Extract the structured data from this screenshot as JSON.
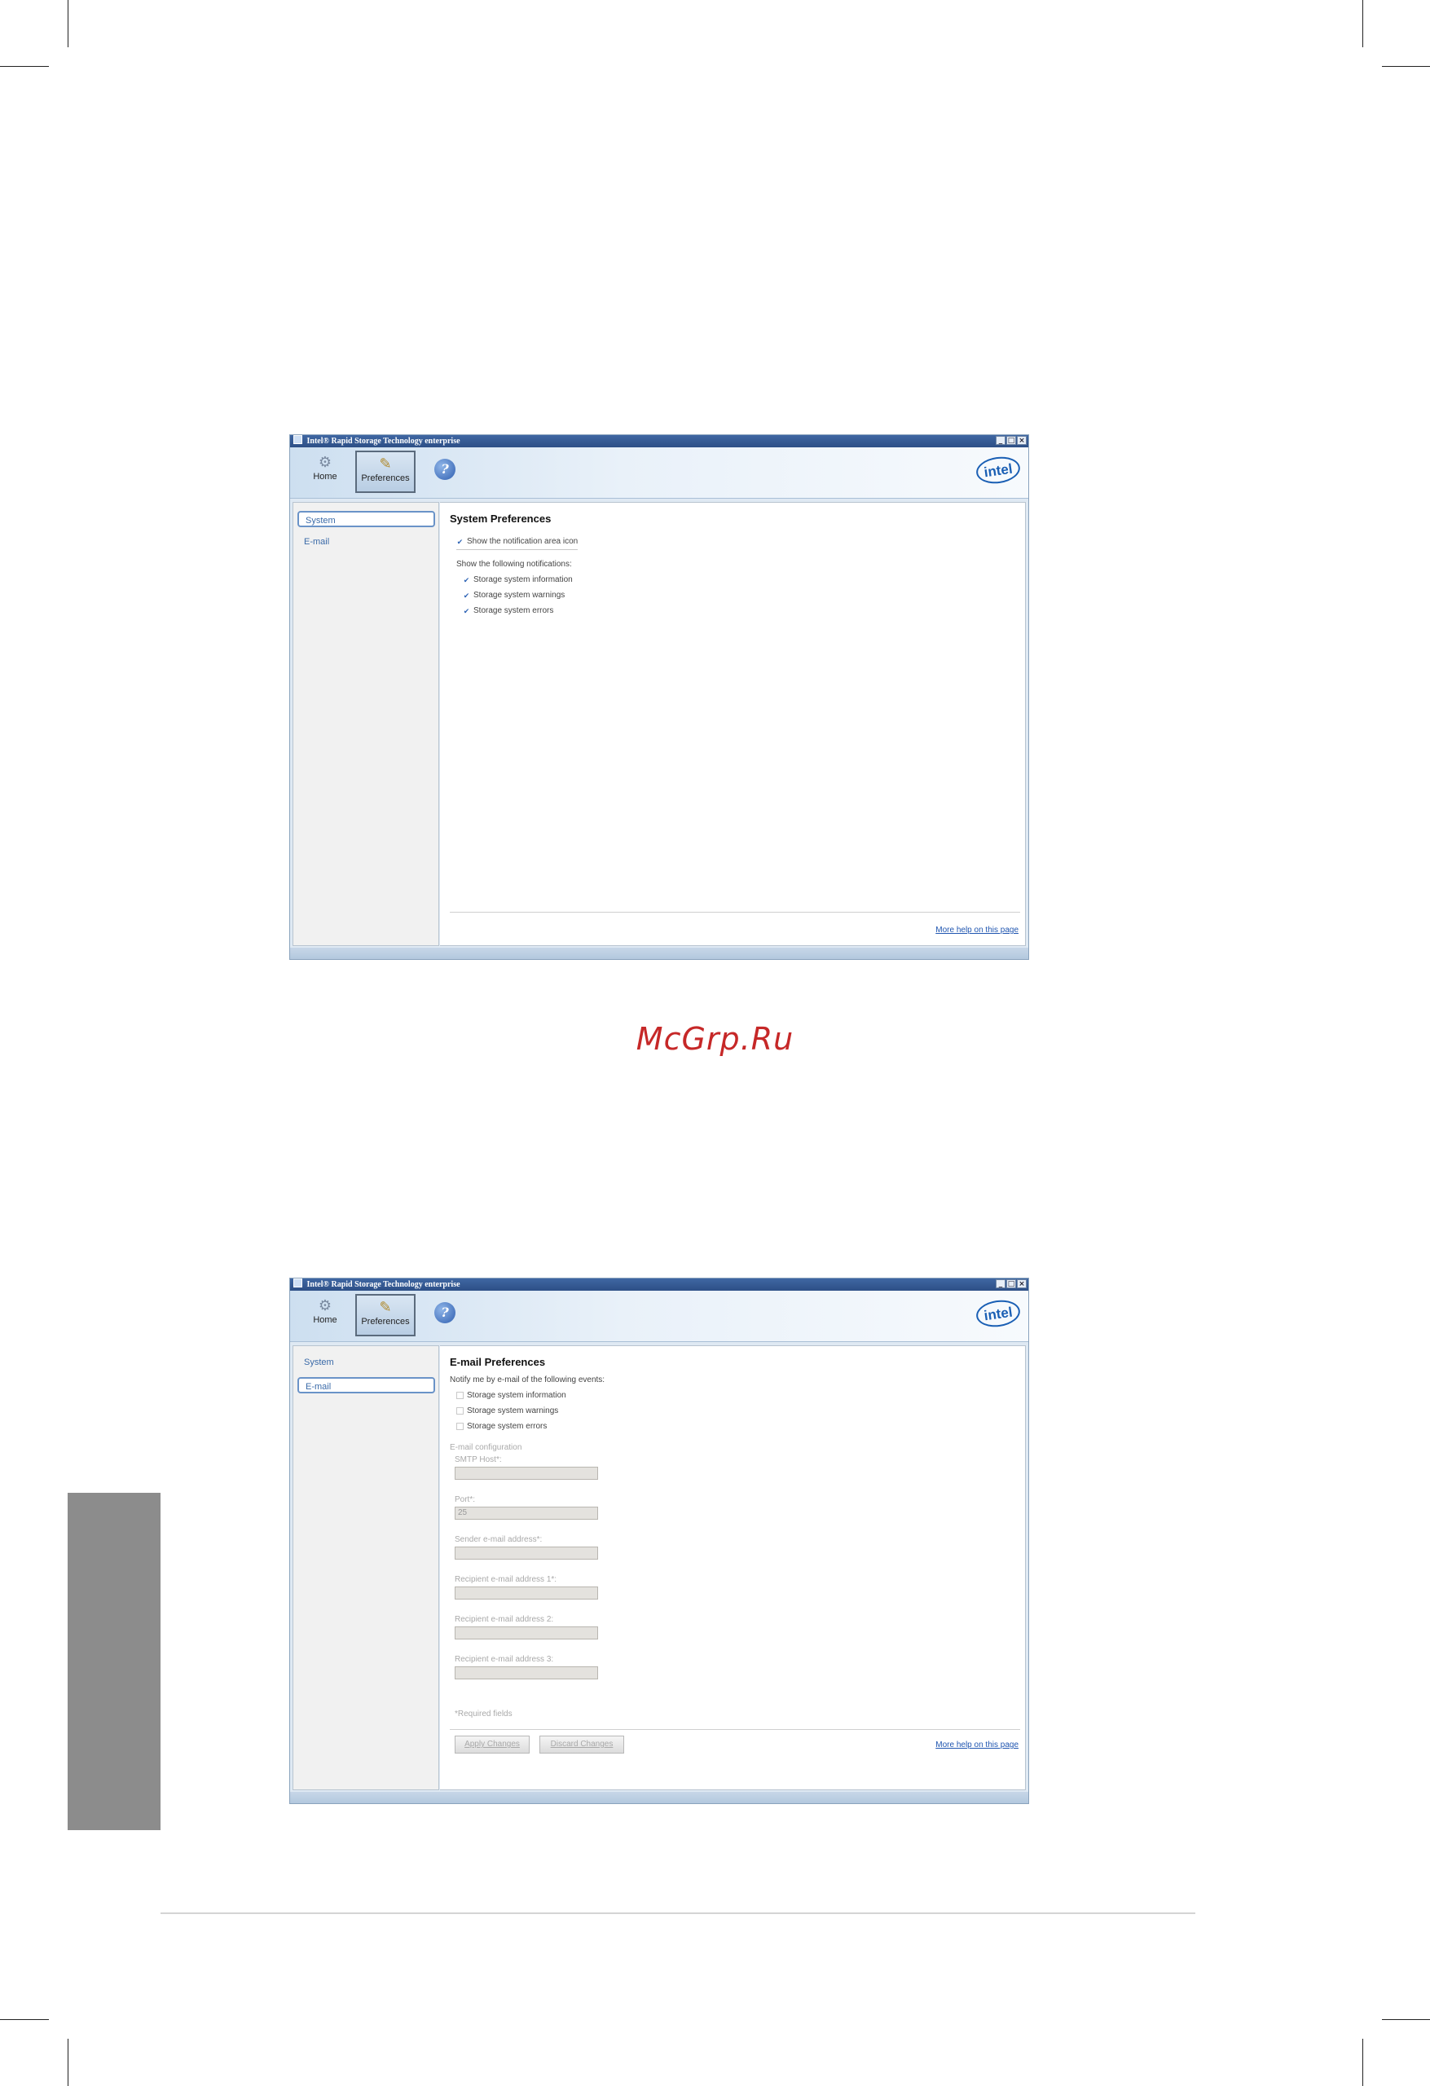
{
  "watermark": "McGrp.Ru",
  "windows": [
    {
      "title": "Intel® Rapid Storage Technology enterprise",
      "window_buttons": [
        "_",
        "□",
        "×"
      ],
      "toolbar": {
        "home": "Home",
        "preferences": "Preferences",
        "help": "?",
        "logo": "intel"
      },
      "nav": [
        "System",
        "E-mail"
      ],
      "selected_nav": "System",
      "heading": "System Preferences",
      "show_icon": "Show the notification area icon",
      "show_following": "Show the following notifications:",
      "notifications": [
        "Storage system information",
        "Storage system warnings",
        "Storage system errors"
      ],
      "help_link": "More help on this page"
    },
    {
      "title": "Intel® Rapid Storage Technology enterprise",
      "window_buttons": [
        "_",
        "□",
        "×"
      ],
      "toolbar": {
        "home": "Home",
        "preferences": "Preferences",
        "help": "?",
        "logo": "intel"
      },
      "nav": [
        "System",
        "E-mail"
      ],
      "selected_nav": "E-mail",
      "heading": "E-mail Preferences",
      "notify_label": "Notify me by e-mail of the following events:",
      "events": [
        "Storage system information",
        "Storage system warnings",
        "Storage system errors"
      ],
      "config_label": "E-mail configuration",
      "fields": [
        {
          "label": "SMTP Host*:",
          "value": ""
        },
        {
          "label": "Port*:",
          "value": "25"
        },
        {
          "label": "Sender e-mail address*:",
          "value": ""
        },
        {
          "label": "Recipient e-mail address 1*:",
          "value": ""
        },
        {
          "label": "Recipient e-mail address 2:",
          "value": ""
        },
        {
          "label": "Recipient e-mail address 3:",
          "value": ""
        }
      ],
      "required_note": "*Required fields",
      "apply_button": "Apply Changes",
      "discard_button": "Discard Changes",
      "help_link": "More help on this page"
    }
  ]
}
